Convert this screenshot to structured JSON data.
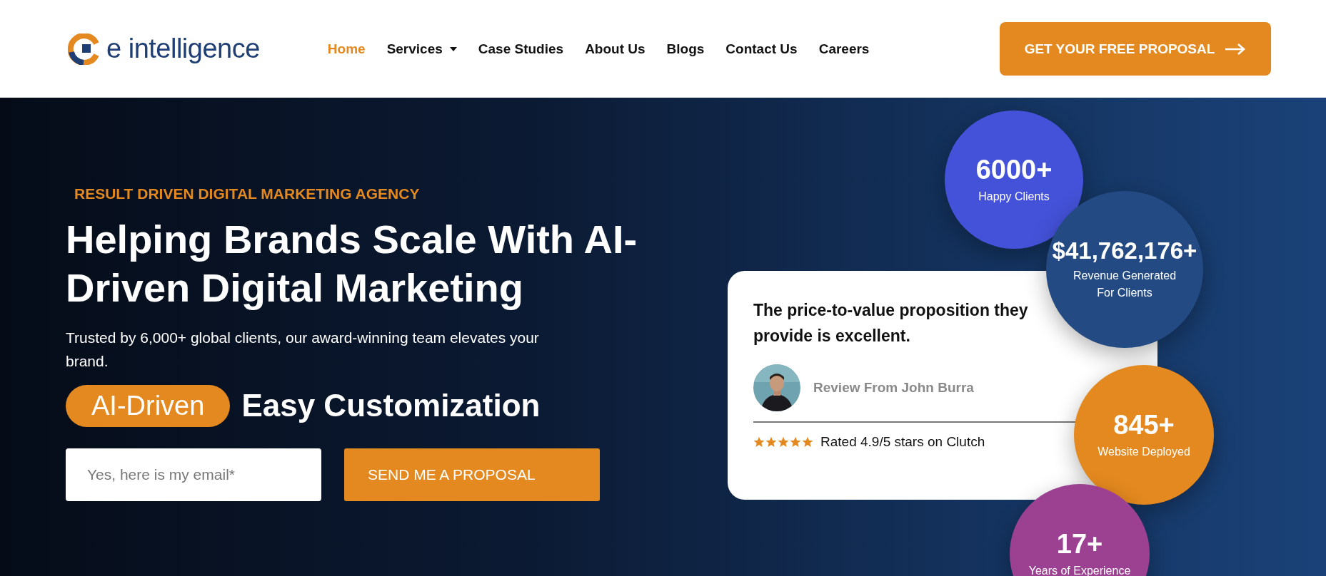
{
  "header": {
    "logo": "e intelligence",
    "nav": [
      {
        "label": "Home",
        "selected": true,
        "has_menu": false
      },
      {
        "label": "Services",
        "selected": false,
        "has_menu": true
      },
      {
        "label": "Case Studies",
        "selected": false,
        "has_menu": false
      },
      {
        "label": "About Us",
        "selected": false,
        "has_menu": false
      },
      {
        "label": "Blogs",
        "selected": false,
        "has_menu": false
      },
      {
        "label": "Contact Us",
        "selected": false,
        "has_menu": false
      },
      {
        "label": "Careers",
        "selected": false,
        "has_menu": false
      }
    ],
    "cta": "GET YOUR FREE PROPOSAL"
  },
  "hero": {
    "eyebrow": "RESULT DRIVEN DIGITAL MARKETING AGENCY",
    "headline": "Helping Brands Scale With AI-Driven Digital Marketing",
    "intro": "Trusted by 6,000+ global clients, our award-winning team elevates your brand.",
    "badge": "AI-Driven",
    "rotating_text": "Easy Customization",
    "email_placeholder": "Yes, here is my email*",
    "submit": "SEND ME A PROPOSAL"
  },
  "review": {
    "quote": "The price-to-value proposition they provide is excellent.",
    "reviewer": "Review From John Burra",
    "stars": 5,
    "rating": "Rated 4.9/5 stars on Clutch"
  },
  "stats": [
    {
      "value": "6000+",
      "label": "Happy Clients",
      "color": "#4452d9"
    },
    {
      "value": "$41,762,176+",
      "label": "Revenue Generated For Clients",
      "color": "#234a82"
    },
    {
      "value": "845+",
      "label": "Website Deployed",
      "color": "#e4891f"
    },
    {
      "value": "17+",
      "label": "Years of Experience",
      "color": "#9c4192"
    }
  ]
}
